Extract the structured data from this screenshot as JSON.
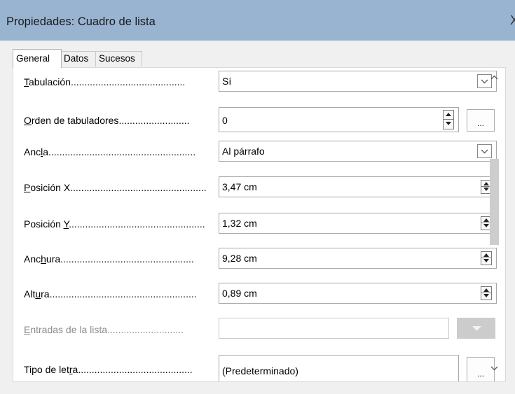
{
  "window": {
    "title": "Propiedades: Cuadro de lista",
    "close": "X"
  },
  "tabs": [
    "General",
    "Datos",
    "Sucesos"
  ],
  "fields": [
    {
      "label_pre": "",
      "label_key": "T",
      "label_post": "abulación",
      "dots": "..........................................",
      "value": "Sí",
      "control": "dropdown"
    },
    {
      "label_pre": "",
      "label_key": "O",
      "label_post": "rden de tabuladores",
      "dots": "..........................",
      "value": "0",
      "control": "spinner-ellipsis"
    },
    {
      "label_pre": "Anc",
      "label_key": "l",
      "label_post": "a",
      "dots": "......................................................",
      "value": "Al párrafo",
      "control": "dropdown"
    },
    {
      "label_pre": "",
      "label_key": "P",
      "label_post": "osición X",
      "dots": "..................................................",
      "value": "3,47 cm",
      "control": "spinner"
    },
    {
      "label_pre": "Posición ",
      "label_key": "Y",
      "label_post": "",
      "dots": "..................................................",
      "value": "1,32 cm",
      "control": "spinner"
    },
    {
      "label_pre": "Anc",
      "label_key": "h",
      "label_post": "ura",
      "dots": ".................................................",
      "value": "9,28 cm",
      "control": "spinner"
    },
    {
      "label_pre": "Alt",
      "label_key": "u",
      "label_post": "ra",
      "dots": "......................................................",
      "value": "0,89 cm",
      "control": "spinner"
    },
    {
      "label_pre": "",
      "label_key": "E",
      "label_post": "ntradas de la lista",
      "dots": "............................",
      "value": "",
      "control": "disabled-dropdown"
    },
    {
      "label_pre": "Tipo de let",
      "label_key": "r",
      "label_post": "a",
      "dots": "..........................................",
      "value": "(Predeterminado)",
      "control": "ellipsis"
    }
  ],
  "ellipsis_label": "...",
  "icons": {
    "close": "close-icon",
    "dropdown": "chevron-down-icon",
    "spin_up": "spin-up-icon",
    "spin_down": "spin-down-icon",
    "scroll_up": "scroll-up-arrow-icon",
    "scroll_down": "scroll-down-arrow-icon"
  },
  "colors": {
    "titlebar": "#99b4d1",
    "panel": "#ffffff",
    "disabled_text": "#8c8c8c",
    "scroll_thumb": "#cdcdcd"
  }
}
